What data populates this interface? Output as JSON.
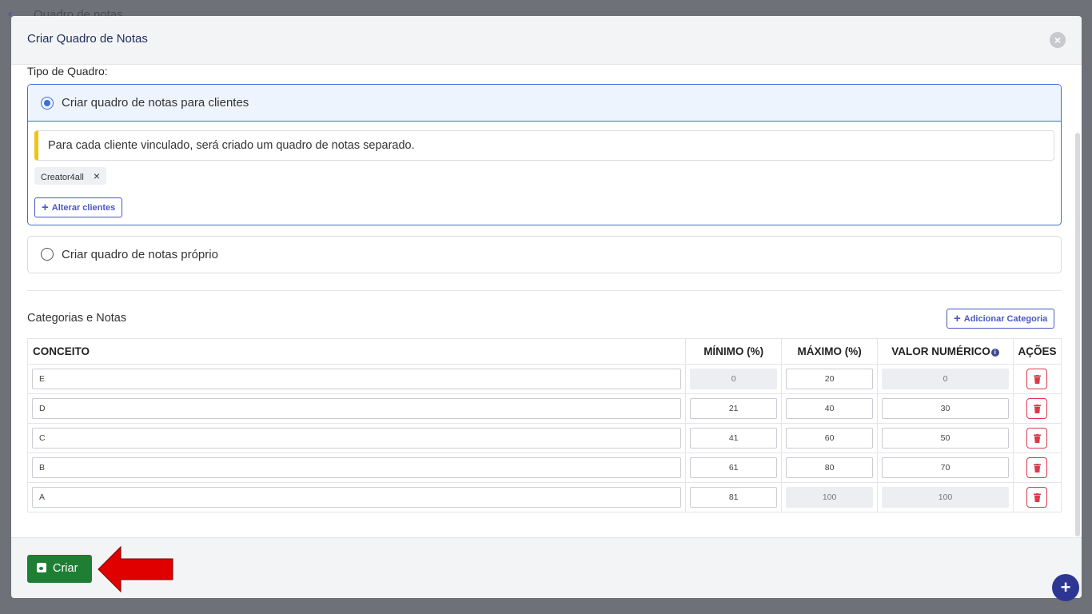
{
  "background": {
    "title": "Quadro de notas"
  },
  "modal": {
    "title": "Criar Quadro de Notas",
    "section_label": "Tipo de Quadro:",
    "option_clients": {
      "label": "Criar quadro de notas para clientes",
      "selected": true,
      "alert": "Para cada cliente vinculado, será criado um quadro de notas separado.",
      "chips": [
        "Creator4all"
      ],
      "alter_button": "Alterar clientes"
    },
    "option_own": {
      "label": "Criar quadro de notas próprio",
      "selected": false
    },
    "categories_title": "Categorias e Notas",
    "add_category_button": "Adicionar Categoria",
    "table": {
      "headers": {
        "concept": "CONCEITO",
        "min": "MÍNIMO (%)",
        "max": "MÁXIMO (%)",
        "value": "VALOR NUMÉRICO",
        "actions": "AÇÕES"
      },
      "rows": [
        {
          "concept": "E",
          "min": "0",
          "max": "20",
          "value": "0"
        },
        {
          "concept": "D",
          "min": "21",
          "max": "40",
          "value": "30"
        },
        {
          "concept": "C",
          "min": "41",
          "max": "60",
          "value": "50"
        },
        {
          "concept": "B",
          "min": "61",
          "max": "80",
          "value": "70"
        },
        {
          "concept": "A",
          "min": "81",
          "max": "100",
          "value": "100"
        }
      ]
    },
    "create_button": "Criar"
  },
  "colors": {
    "primary": "#3d6ee0",
    "success": "#1e7e34",
    "danger": "#d93a4a",
    "warning": "#f2c314",
    "annotation_arrow": "#e00000",
    "fab": "#2d3693"
  },
  "icons": [
    "close-icon",
    "plus-icon",
    "trash-icon",
    "info-icon",
    "save-icon"
  ]
}
